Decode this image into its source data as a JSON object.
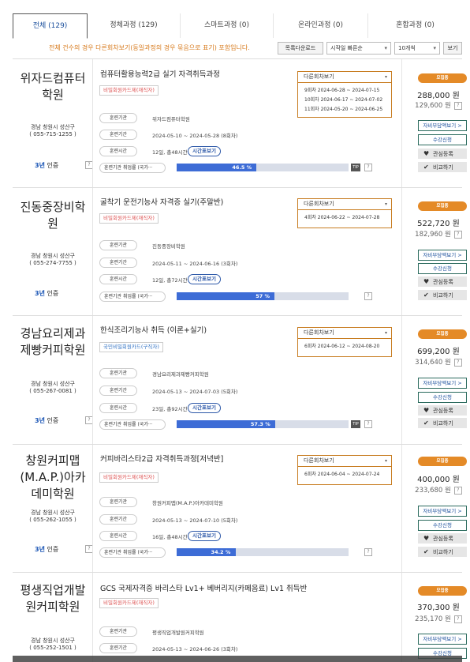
{
  "tabs": [
    {
      "label": "전체 (129)",
      "active": true
    },
    {
      "label": "정체과정 (129)",
      "active": false
    },
    {
      "label": "스마트과정 (0)",
      "active": false
    },
    {
      "label": "온라인과정 (0)",
      "active": false
    },
    {
      "label": "혼합과정 (0)",
      "active": false
    }
  ],
  "notice": "전체 건수의 경우 다른회차보기(동일과정의 경우 묶음으로 표기) 포함입니다.",
  "toolbar": {
    "download_label": "목록다운로드",
    "sort_value": "시작일 빠른순",
    "count_value": "10개씩",
    "view_label": "보기"
  },
  "labels": {
    "institution": "훈련기관",
    "period": "훈련기간",
    "time": "훈련시간",
    "employment": "훈련기관 취업률 (국가···",
    "schedule_button": "시간표보기",
    "rounds_header": "다른회차보기",
    "badge": "모집중",
    "self_pay": "자비부담액보기 >",
    "apply": "수강신청",
    "favorite": "관심등록",
    "compare": "비교하기",
    "certified": "인증",
    "tip": "TIP",
    "q": "?"
  },
  "courses": [
    {
      "academy": "위자드컴퓨터학원",
      "address": "경남 창원시 성산구",
      "phone": "( 055-715-1255 )",
      "grade": "3년",
      "title": "컴퓨터활용능력2급 실기 자격취득과정",
      "tag": "비밀회원카드제(재직자)",
      "institution": "위자드컴퓨터학원",
      "period": "2024-05-10 ~ 2024-05-28 (8회차)",
      "time": "12일, 총48시간",
      "employment_rate": 46.5,
      "employment_label": "46.5 %",
      "rounds": [
        "9회차 2024-06-28 ~ 2024-07-15",
        "10회차 2024-06-17 ~ 2024-07-02",
        "11회차 2024-05-20 ~ 2024-06-25"
      ],
      "price": "288,000 원",
      "subprice": "129,600 원"
    },
    {
      "academy": "진동중장비학원",
      "address": "경남 창원시 성산구",
      "phone": "( 055-274-7755 )",
      "grade": "3년",
      "title": "굴착기 운전기능사 자격증 실기(주말반)",
      "tag": "비밀회원카드제(재직자)",
      "institution": "진동중장비학원",
      "period": "2024-05-11 ~ 2024-06-16 (3회차)",
      "time": "12일, 총72시간",
      "employment_rate": 57,
      "employment_label": "57 %",
      "rounds": [
        "4회차 2024-06-22 ~ 2024-07-28"
      ],
      "price": "522,720 원",
      "subprice": "182,960 원"
    },
    {
      "academy": "경남요리제과제빵커피학원",
      "address": "경남 창원시 성산구",
      "phone": "( 055-267-0081 )",
      "grade": "3년",
      "title": "한식조리기능사 취득 (이론+실기)",
      "tag": "국민비밀회원카드(구직자)",
      "institution": "경남요리제과제빵커피학원",
      "period": "2024-05-13 ~ 2024-07-03 (5회차)",
      "time": "23일, 총92시간",
      "employment_rate": 57.3,
      "employment_label": "57.3 %",
      "rounds": [
        "6회차 2024-06-12 ~ 2024-08-20"
      ],
      "price": "699,200 원",
      "subprice": "314,640 원"
    },
    {
      "academy": "창원커피맵(M.A.P.)아카데미학원",
      "address": "경남 창원시 성산구",
      "phone": "( 055-262-1055 )",
      "grade": "3년",
      "title": "커피바리스타2급 자격취득과정[저녁반]",
      "tag": "비밀회원카드제(재직자)",
      "institution": "창원커피맵(M.A.P.)아카데미학원",
      "period": "2024-05-13 ~ 2024-07-10 (5회차)",
      "time": "16일, 총48시간",
      "employment_rate": 34.2,
      "employment_label": "34.2 %",
      "rounds": [
        "6회차 2024-06-04 ~ 2024-07-24"
      ],
      "price": "400,000 원",
      "subprice": "233,680 원"
    },
    {
      "academy": "평생직업개발원커피학원",
      "address": "경남 창원시 성산구",
      "phone": "( 055-252-1501 )",
      "title": "GCS 국제자격증 바리스타 Lv1+ 베버리지(카페음료) Lv1 취득반",
      "tag": "비밀회원카드제(재직자)",
      "institution": "평생직업개발원커피학원",
      "period": "2024-05-13 ~ 2024-06-26 (3회차)",
      "price": "370,300 원",
      "subprice": "235,170 원"
    }
  ]
}
